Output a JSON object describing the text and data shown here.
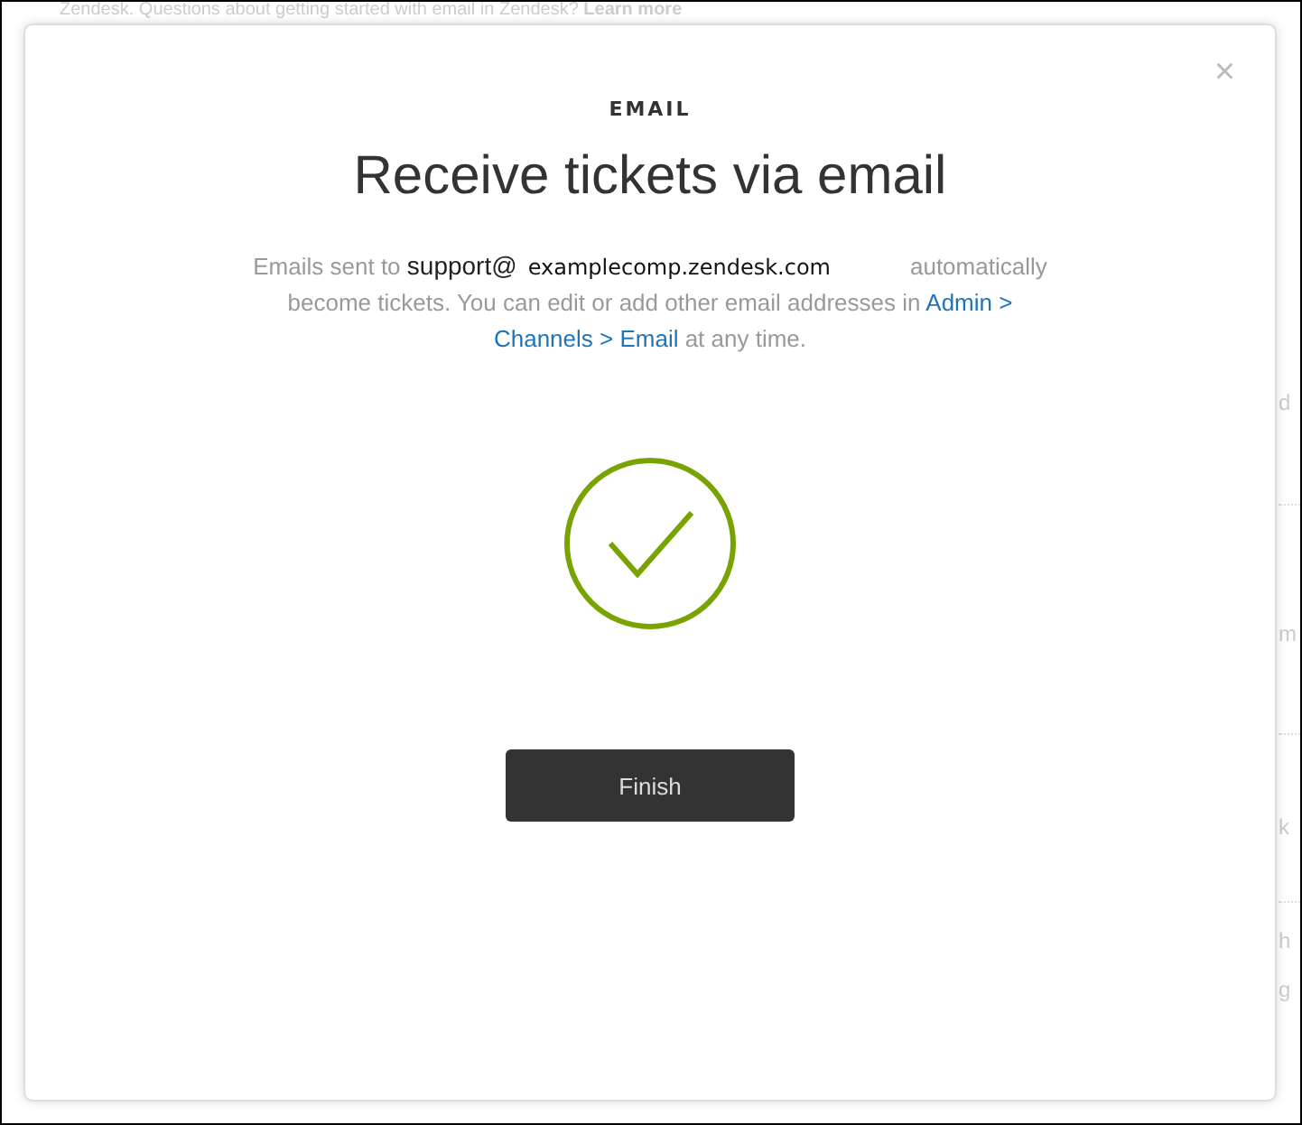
{
  "background": {
    "intro": "Zendesk. Questions about getting started with email in Zendesk?",
    "intro_link": "Learn more",
    "fragments": [
      "d",
      "m",
      "k",
      "h",
      "g"
    ]
  },
  "modal": {
    "close": "×",
    "eyebrow": "EMAIL",
    "title": "Receive tickets via email",
    "message": [
      {
        "kind": "text",
        "text": "Emails sent to "
      },
      {
        "kind": "strong",
        "text": "support@"
      },
      {
        "kind": "address",
        "text": "examplecomp.zendesk.com"
      },
      {
        "kind": "text",
        "text": "automatically become tickets. You can edit or add other email addresses in "
      },
      {
        "kind": "link",
        "text": "Admin >"
      },
      {
        "kind": "break"
      },
      {
        "kind": "link",
        "text": "Channels > Email"
      },
      {
        "kind": "text",
        "text": " at any time."
      }
    ],
    "button": "Finish"
  }
}
